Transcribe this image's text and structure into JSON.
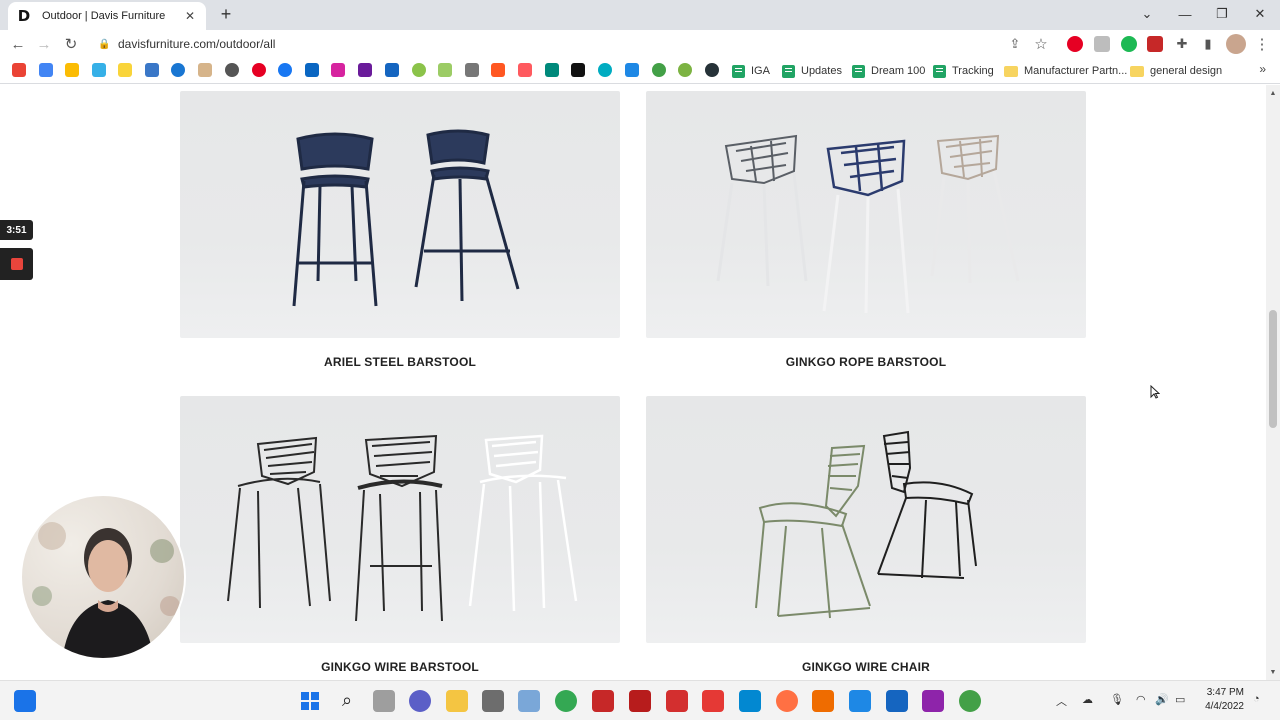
{
  "browser": {
    "tab": {
      "favicon_letter": "D",
      "title": "Outdoor | Davis Furniture"
    },
    "url": "davisfurniture.com/outdoor/all",
    "bookmarks": {
      "items": [
        {
          "id": "iga",
          "label": "IGA",
          "kind": "sheet"
        },
        {
          "id": "updates",
          "label": "Updates",
          "kind": "sheet"
        },
        {
          "id": "dream100",
          "label": "Dream 100",
          "kind": "sheet"
        },
        {
          "id": "tracking",
          "label": "Tracking",
          "kind": "sheet"
        },
        {
          "id": "manufacturer",
          "label": "Manufacturer Partn...",
          "kind": "folder"
        },
        {
          "id": "general-design",
          "label": "general design",
          "kind": "folder"
        }
      ],
      "more": "»"
    }
  },
  "products": [
    {
      "name": "ARIEL STEEL BARSTOOL"
    },
    {
      "name": "GINKGO ROPE BARSTOOL"
    },
    {
      "name": "GINKGO WIRE BARSTOOL"
    },
    {
      "name": "GINKGO WIRE CHAIR"
    }
  ],
  "recorder": {
    "timer": "3:51"
  },
  "taskbar": {
    "time": "3:47 PM",
    "date": "4/4/2022"
  },
  "colors": {
    "accent": "#1a73e8",
    "sheet": "#21a464",
    "stop": "#e8453c"
  }
}
